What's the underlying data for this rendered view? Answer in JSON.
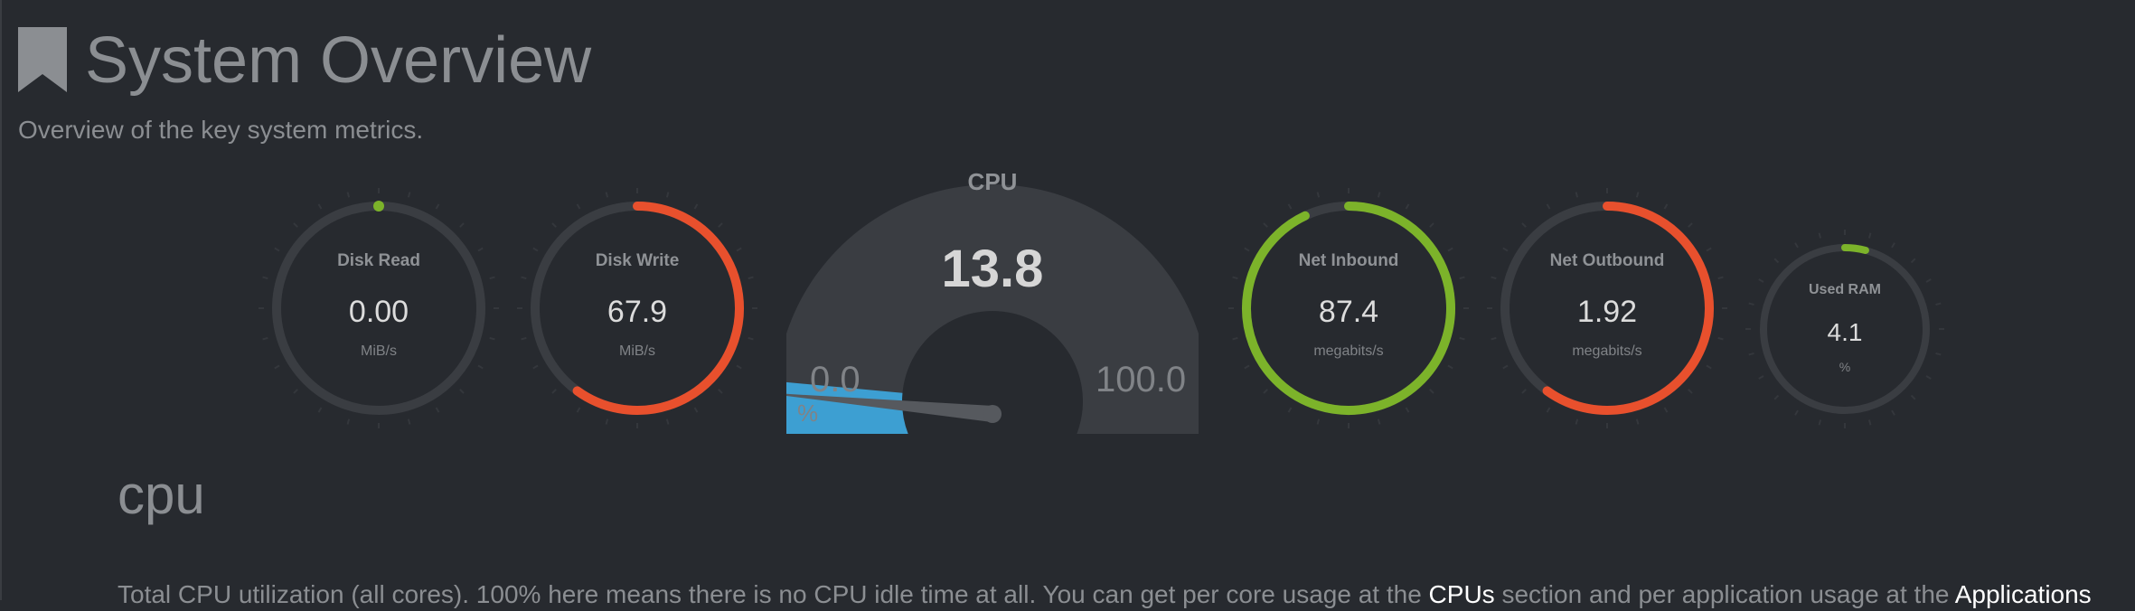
{
  "header": {
    "title": "System Overview",
    "subtitle": "Overview of the key system metrics."
  },
  "colors": {
    "background": "#272a2f",
    "track": "#3a3d42",
    "green": "#7cb32a",
    "red": "#e8502d",
    "blue": "#3d9fd2",
    "muted_text": "#8b8e92"
  },
  "icons": {
    "title_icon": "bookmark-icon"
  },
  "gauges": [
    {
      "id": "disk-read",
      "label": "Disk Read",
      "value": "0.00",
      "unit": "MiB/s",
      "fill": 0.0,
      "color": "#7cb32a",
      "size": "large"
    },
    {
      "id": "disk-write",
      "label": "Disk Write",
      "value": "67.9",
      "unit": "MiB/s",
      "fill": 0.6,
      "color": "#e8502d",
      "size": "large"
    },
    {
      "id": "net-inbound",
      "label": "Net Inbound",
      "value": "87.4",
      "unit": "megabits/s",
      "fill": 0.93,
      "color": "#7cb32a",
      "size": "large"
    },
    {
      "id": "net-outbound",
      "label": "Net Outbound",
      "value": "1.92",
      "unit": "megabits/s",
      "fill": 0.6,
      "color": "#e8502d",
      "size": "large"
    },
    {
      "id": "used-ram",
      "label": "Used RAM",
      "value": "4.1",
      "unit": "%",
      "fill": 0.041,
      "color": "#7cb32a",
      "size": "small"
    }
  ],
  "cpu_gauge": {
    "title": "CPU",
    "value": "13.8",
    "value_num": 13.8,
    "min": "0.0",
    "max": "100.0",
    "unit": "%"
  },
  "section": {
    "title": "cpu",
    "desc_before": "Total CPU utilization (all cores). 100% here means there is no CPU idle time at all. You can get per core usage at the ",
    "link1": "CPUs",
    "desc_middle": " section and per application usage at the ",
    "link2": "Applications"
  }
}
